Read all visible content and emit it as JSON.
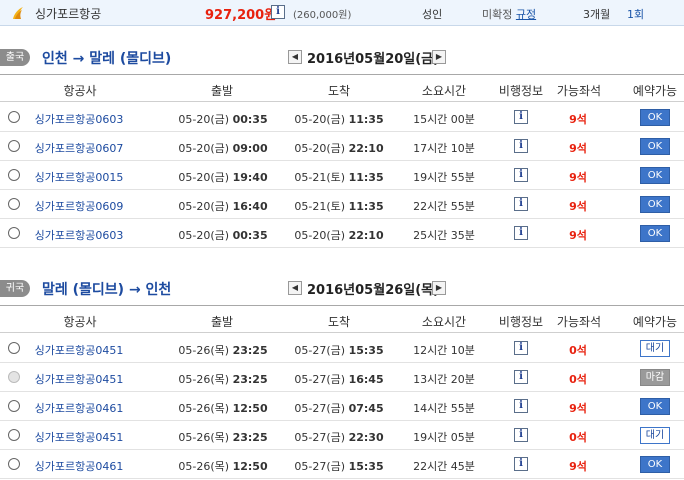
{
  "summary": {
    "airline": "싱가포르항공",
    "price": "927,200원",
    "tax": "(260,000원)",
    "passenger": "성인",
    "status_prefix": "미확정",
    "rule_link": "규정",
    "stay": "3개월",
    "count": "1회"
  },
  "columns": [
    "항공사",
    "출발",
    "도착",
    "소요시간",
    "비행정보",
    "가능좌석",
    "예약가능"
  ],
  "outbound": {
    "tag": "출국",
    "route": "인천 → 말레 (몰디브)",
    "date": "2016년05월20일(금)",
    "rows": [
      {
        "airline": "싱가포르항공0603",
        "dep_date": "05-20(금)",
        "dep_time": "00:35",
        "arr_date": "05-20(금)",
        "arr_time": "11:35",
        "duration": "15시간 00분",
        "seats": "9석",
        "action": "OK",
        "state": "ok"
      },
      {
        "airline": "싱가포르항공0607",
        "dep_date": "05-20(금)",
        "dep_time": "09:00",
        "arr_date": "05-20(금)",
        "arr_time": "22:10",
        "duration": "17시간 10분",
        "seats": "9석",
        "action": "OK",
        "state": "ok"
      },
      {
        "airline": "싱가포르항공0015",
        "dep_date": "05-20(금)",
        "dep_time": "19:40",
        "arr_date": "05-21(토)",
        "arr_time": "11:35",
        "duration": "19시간 55분",
        "seats": "9석",
        "action": "OK",
        "state": "ok"
      },
      {
        "airline": "싱가포르항공0609",
        "dep_date": "05-20(금)",
        "dep_time": "16:40",
        "arr_date": "05-21(토)",
        "arr_time": "11:35",
        "duration": "22시간 55분",
        "seats": "9석",
        "action": "OK",
        "state": "ok"
      },
      {
        "airline": "싱가포르항공0603",
        "dep_date": "05-20(금)",
        "dep_time": "00:35",
        "arr_date": "05-20(금)",
        "arr_time": "22:10",
        "duration": "25시간 35분",
        "seats": "9석",
        "action": "OK",
        "state": "ok"
      }
    ]
  },
  "inbound": {
    "tag": "귀국",
    "route": "말레 (몰디브) → 인천",
    "date": "2016년05월26일(목)",
    "rows": [
      {
        "airline": "싱가포르항공0451",
        "dep_date": "05-26(목)",
        "dep_time": "23:25",
        "arr_date": "05-27(금)",
        "arr_time": "15:35",
        "duration": "12시간 10분",
        "seats": "0석",
        "action": "대기",
        "state": "wait"
      },
      {
        "airline": "싱가포르항공0451",
        "dep_date": "05-26(목)",
        "dep_time": "23:25",
        "arr_date": "05-27(금)",
        "arr_time": "16:45",
        "duration": "13시간 20분",
        "seats": "0석",
        "action": "마감",
        "state": "closed"
      },
      {
        "airline": "싱가포르항공0461",
        "dep_date": "05-26(목)",
        "dep_time": "12:50",
        "arr_date": "05-27(금)",
        "arr_time": "07:45",
        "duration": "14시간 55분",
        "seats": "9석",
        "action": "OK",
        "state": "ok"
      },
      {
        "airline": "싱가포르항공0451",
        "dep_date": "05-26(목)",
        "dep_time": "23:25",
        "arr_date": "05-27(금)",
        "arr_time": "22:30",
        "duration": "19시간 05분",
        "seats": "0석",
        "action": "대기",
        "state": "wait"
      },
      {
        "airline": "싱가포르항공0461",
        "dep_date": "05-26(목)",
        "dep_time": "12:50",
        "arr_date": "05-27(금)",
        "arr_time": "15:35",
        "duration": "22시간 45분",
        "seats": "9석",
        "action": "OK",
        "state": "ok"
      }
    ]
  },
  "icons": {
    "info": "info-icon",
    "prev": "arrow-left-icon",
    "next": "arrow-right-icon",
    "logo": "airline-logo"
  },
  "colors": {
    "price": "#e8210e",
    "seats": "#e8210e",
    "ok_button": "#3d75c9",
    "route": "#1d4ba0",
    "closed_button": "#9a9a9a"
  }
}
